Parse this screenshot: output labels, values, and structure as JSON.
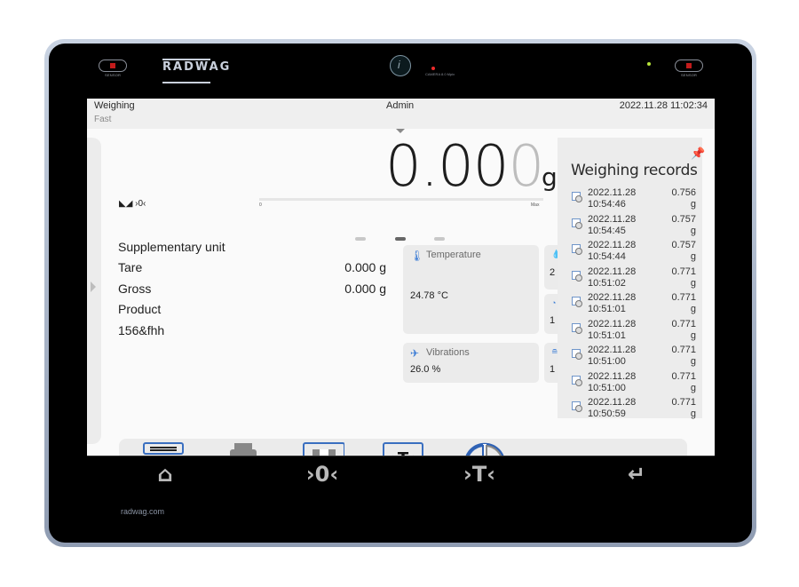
{
  "device": {
    "brand": "RADWAG",
    "left_sensor_label": "SENSOR",
    "right_sensor_label": "SENSOR",
    "camera_label": "CAMERA 8.0 Mpix",
    "website": "radwag.com"
  },
  "statusbar": {
    "mode": "Weighing",
    "profile": "Fast",
    "user": "Admin",
    "datetime": "2022.11.28 11:02:34"
  },
  "display": {
    "reading_main": "0.00",
    "reading_last_digit": "0",
    "unit": "g",
    "stability_zero_indicator": "◣◢ ›0‹",
    "bargraph_min": "0",
    "bargraph_max": "Max",
    "bargraph_fill_percent": 0
  },
  "info_rows": [
    {
      "label": "Supplementary unit",
      "value": ""
    },
    {
      "label": "Tare",
      "value": "0.000 g"
    },
    {
      "label": "Gross",
      "value": "0.000 g"
    },
    {
      "label": "Product",
      "value": ""
    },
    {
      "label": "156&fhh",
      "value": ""
    }
  ],
  "pager": {
    "pages": 3,
    "active": 2
  },
  "widgets": [
    {
      "title": "Temperature",
      "icon": "thermometer-icon",
      "value": "24.78 °C"
    },
    {
      "title": "Vibrations",
      "icon": "vibration-icon",
      "value": "26.0 %"
    },
    {
      "title": "",
      "icon": "humidity-icon",
      "value": "2"
    },
    {
      "title": "",
      "icon": "pressure-icon",
      "value": "1"
    },
    {
      "title": "",
      "icon": "level-icon",
      "value": "1"
    }
  ],
  "toolbar": {
    "buttons": [
      {
        "name": "header-print-button",
        "icon": "print-header-icon"
      },
      {
        "name": "footer-print-button",
        "icon": "print-footer-icon"
      },
      {
        "name": "save-record-button",
        "icon": "save-check-icon"
      },
      {
        "name": "tare-confirm-button",
        "icon": "tare-check-icon"
      },
      {
        "name": "level-button",
        "icon": "level-quadrant-icon"
      },
      {
        "name": "extra-button",
        "icon": "bracket-icon"
      }
    ]
  },
  "records": {
    "title": "Weighing records",
    "items": [
      {
        "date": "2022.11.28",
        "time": "10:54:46",
        "value": "0.756",
        "unit": "g"
      },
      {
        "date": "2022.11.28",
        "time": "10:54:45",
        "value": "0.757",
        "unit": "g"
      },
      {
        "date": "2022.11.28",
        "time": "10:54:44",
        "value": "0.757",
        "unit": "g"
      },
      {
        "date": "2022.11.28",
        "time": "10:51:02",
        "value": "0.771",
        "unit": "g"
      },
      {
        "date": "2022.11.28",
        "time": "10:51:01",
        "value": "0.771",
        "unit": "g"
      },
      {
        "date": "2022.11.28",
        "time": "10:51:01",
        "value": "0.771",
        "unit": "g"
      },
      {
        "date": "2022.11.28",
        "time": "10:51:00",
        "value": "0.771",
        "unit": "g"
      },
      {
        "date": "2022.11.28",
        "time": "10:51:00",
        "value": "0.771",
        "unit": "g"
      },
      {
        "date": "2022.11.28",
        "time": "10:50:59",
        "value": "0.771",
        "unit": "g"
      }
    ]
  },
  "navbar": {
    "home": "⌂",
    "zero": "›0‹",
    "tare": "›T‹",
    "enter": "↵"
  },
  "colors": {
    "accent": "#3a6fc0",
    "led_red": "#c21b1b",
    "led_green": "#b7e43a"
  }
}
